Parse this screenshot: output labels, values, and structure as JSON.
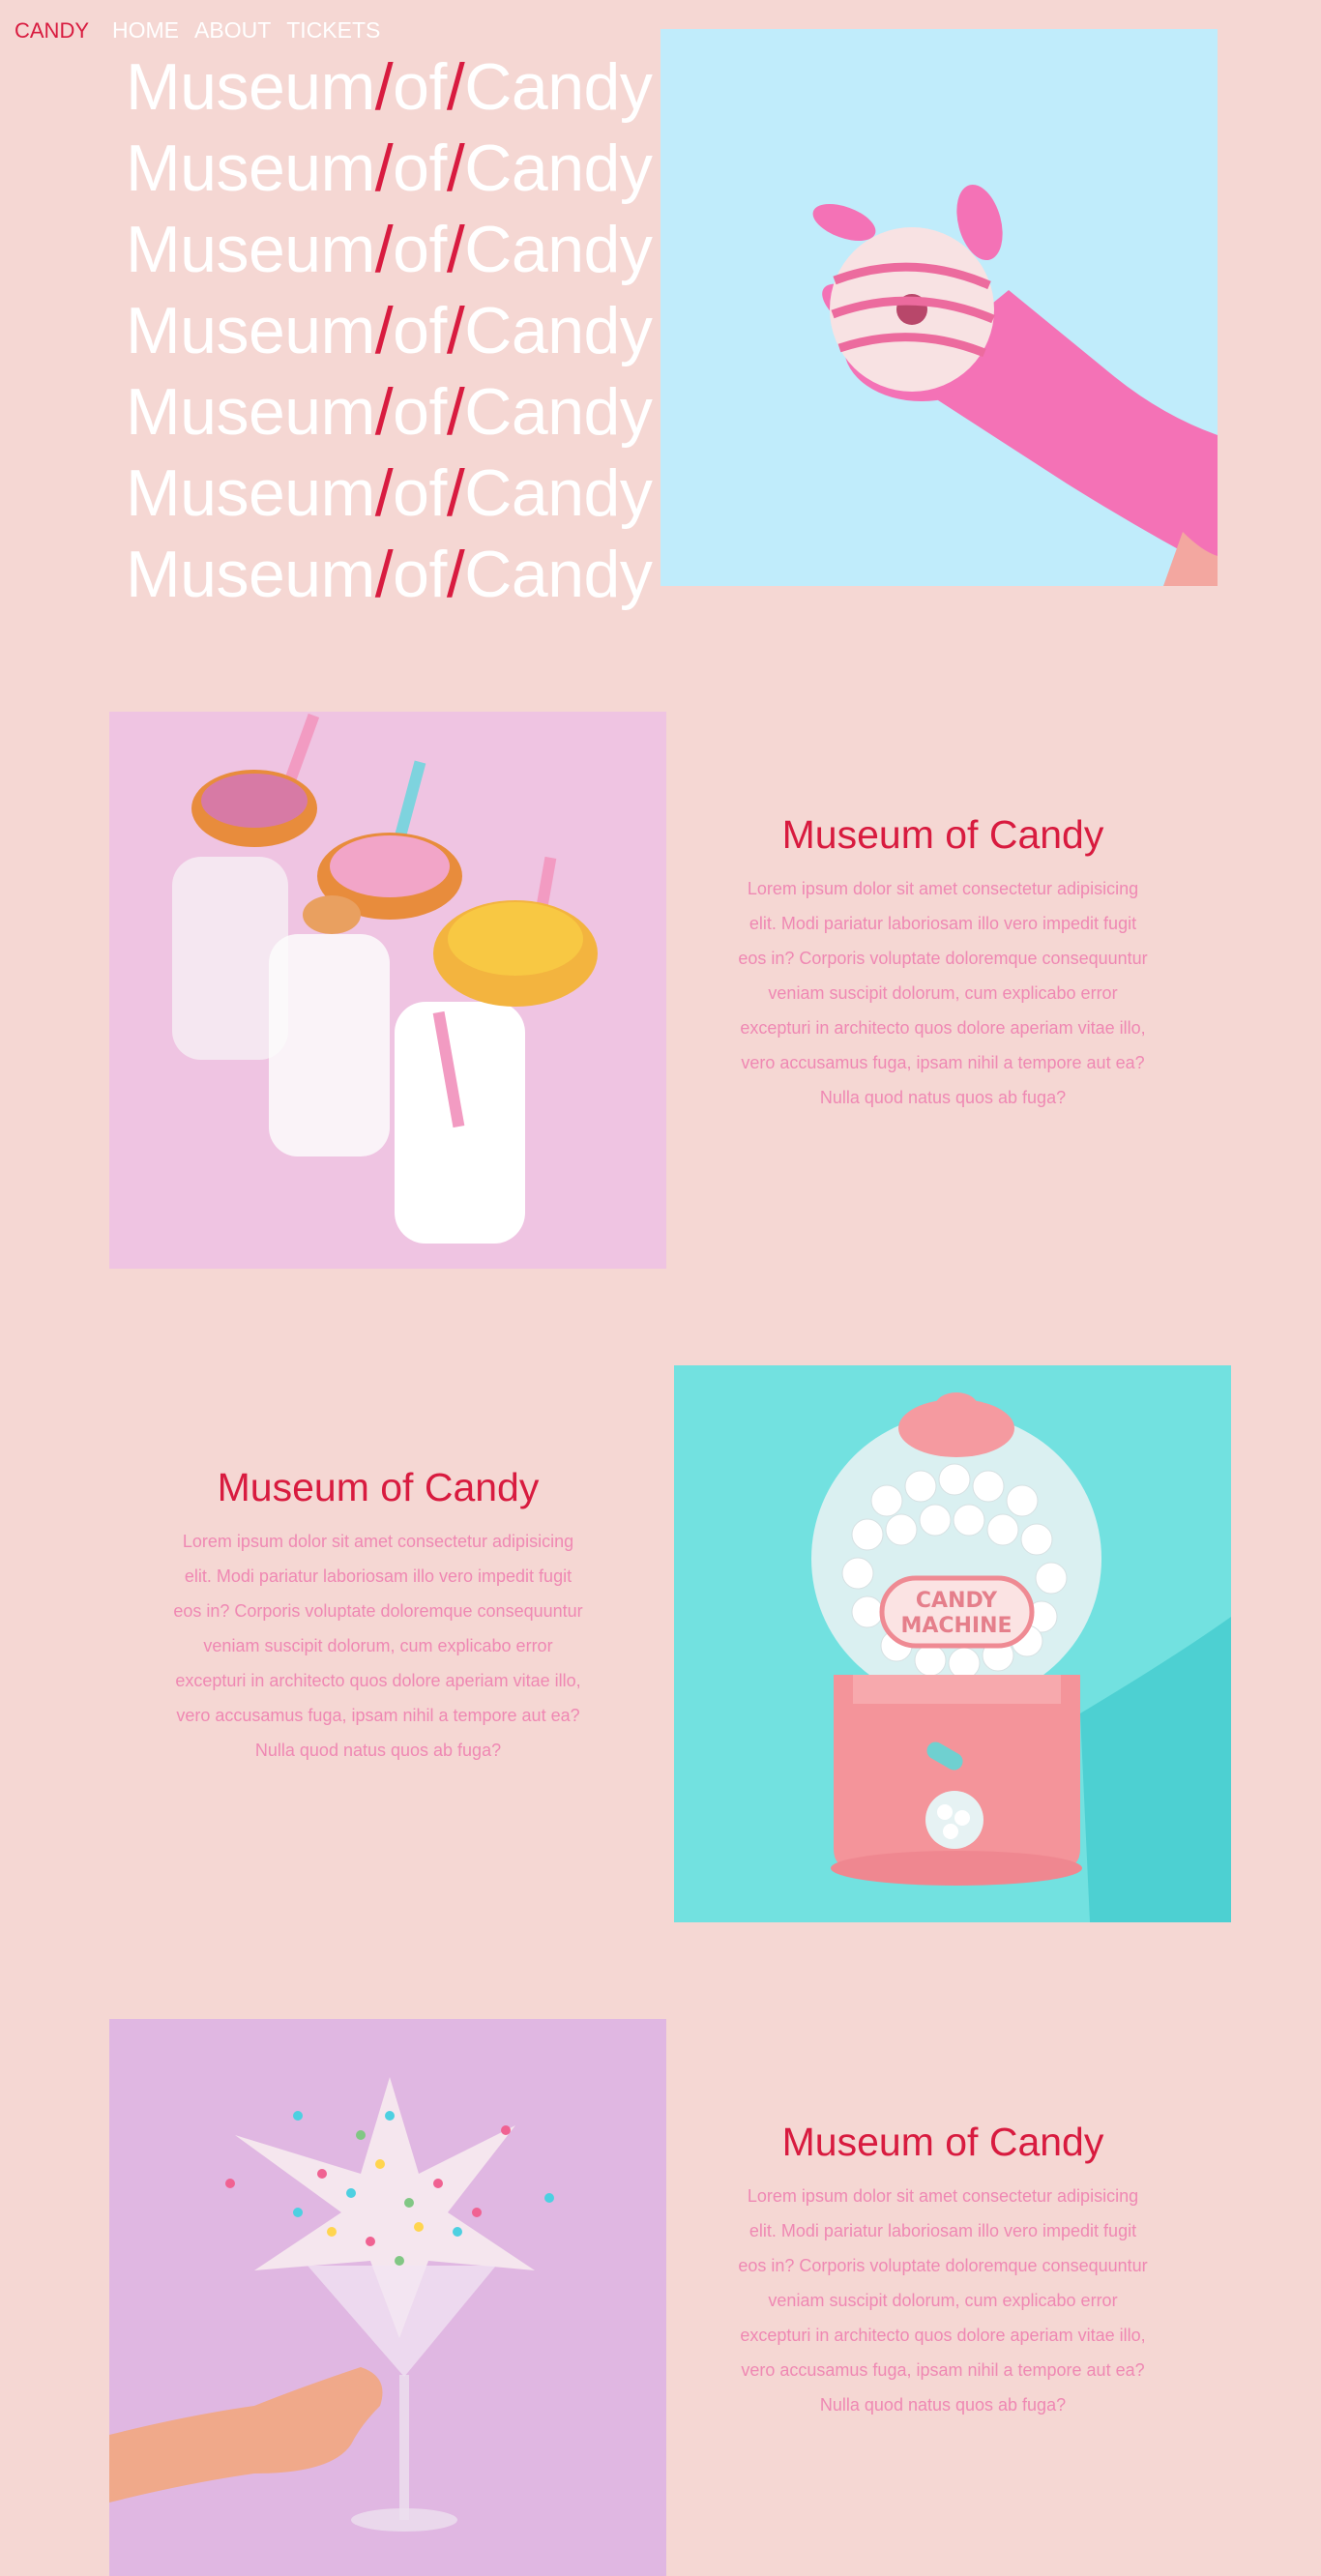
{
  "nav": {
    "brand": "CANDY",
    "links": [
      "HOME",
      "ABOUT",
      "TICKETS"
    ]
  },
  "hero": {
    "title_words": [
      "Museum",
      "/",
      "of",
      "/",
      "Candy"
    ],
    "repeat_count": 7
  },
  "sections": [
    {
      "title": "Museum of Candy",
      "body": "Lorem ipsum dolor sit amet consectetur adipisicing elit. Modi pariatur laboriosam illo vero impedit fugit eos in? Corporis voluptate doloremque consequuntur veniam suscipit dolorum, cum explicabo error excepturi in architecto quos dolore aperiam vitae illo, vero accusamus fuga, ipsam nihil a tempore aut ea? Nulla quod natus quos ab fuga?"
    },
    {
      "title": "Museum of Candy",
      "body": "Lorem ipsum dolor sit amet consectetur adipisicing elit. Modi pariatur laboriosam illo vero impedit fugit eos in? Corporis voluptate doloremque consequuntur veniam suscipit dolorum, cum explicabo error excepturi in architecto quos dolore aperiam vitae illo, vero accusamus fuga, ipsam nihil a tempore aut ea? Nulla quod natus quos ab fuga?"
    },
    {
      "title": "Museum of Candy",
      "body": "Lorem ipsum dolor sit amet consectetur adipisicing elit. Modi pariatur laboriosam illo vero impedit fugit eos in? Corporis voluptate doloremque consequuntur veniam suscipit dolorum, cum explicabo error excepturi in architecto quos dolore aperiam vitae illo, vero accusamus fuga, ipsam nihil a tempore aut ea? Nulla quod natus quos ab fuga?"
    }
  ],
  "images": {
    "hero": {
      "label": "pink-gloved hand holding a striped donut",
      "bg": "#c0ecfb"
    },
    "donut_milk": {
      "label": "milk bottles topped with sprinkle donuts",
      "bg": "#efc4e2"
    },
    "gumball": {
      "label": "pink gumball machine",
      "bg": "#72e1e0",
      "machine_text": [
        "CANDY",
        "MACHINE"
      ]
    },
    "sprinkles": {
      "label": "martini glass with sprinkles",
      "bg": "#e0b7e2"
    }
  },
  "colors": {
    "page_bg": "#f5d7d3",
    "accent": "#d81b3f",
    "body_text": "#ef88b3"
  }
}
